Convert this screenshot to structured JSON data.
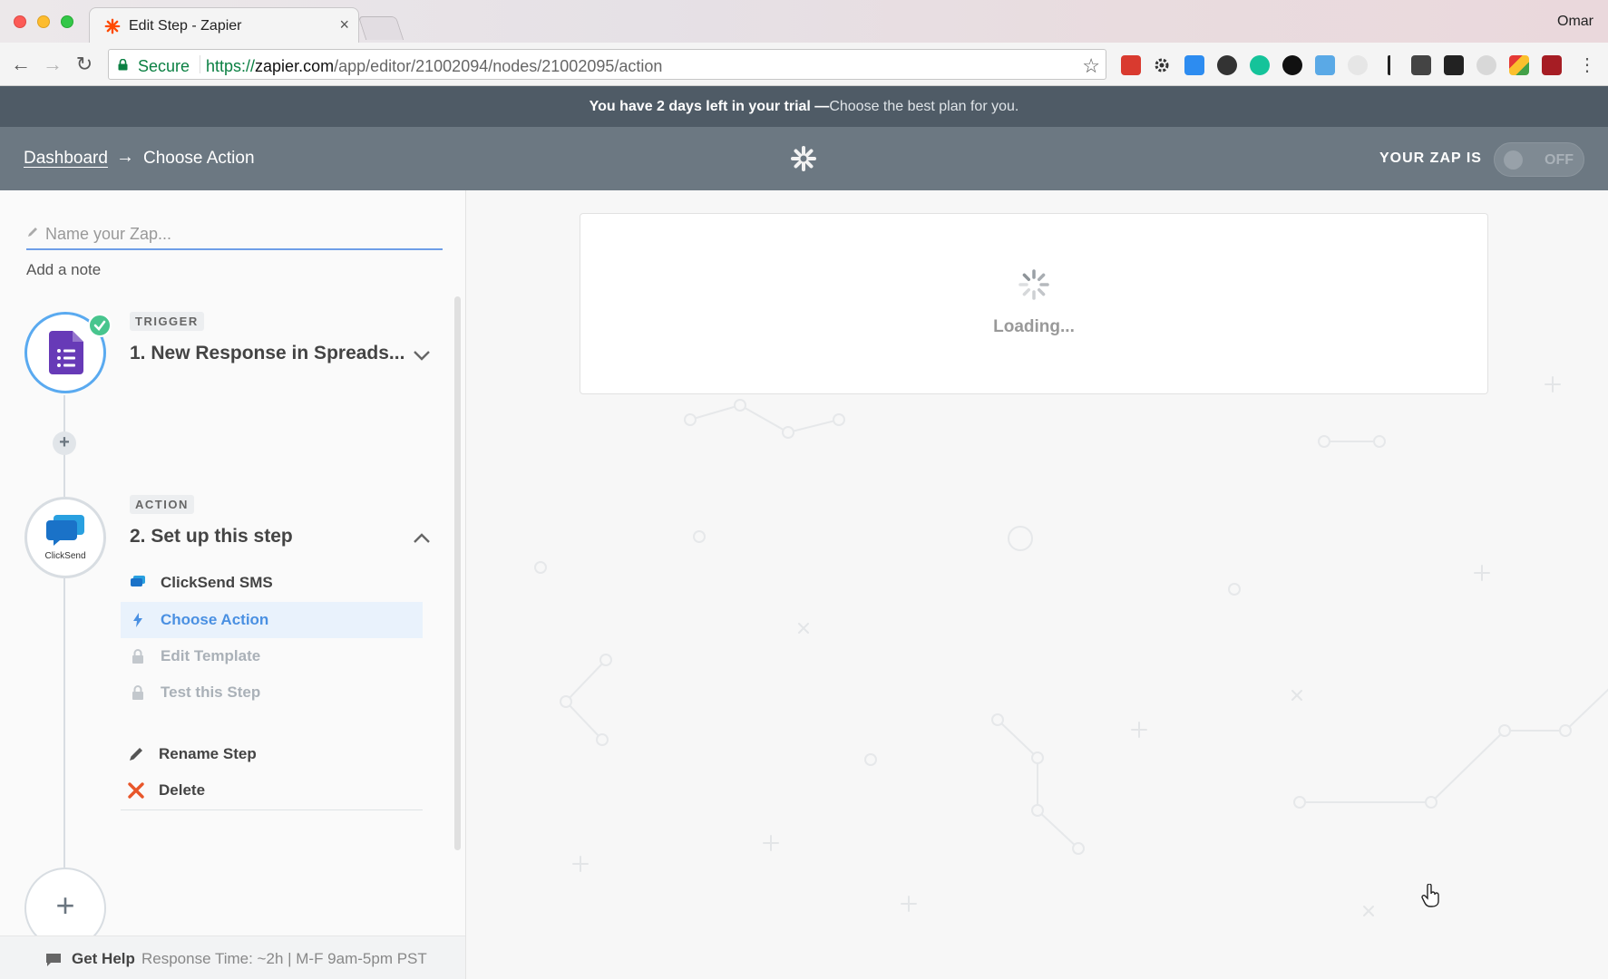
{
  "browser": {
    "tab_title": "Edit Step - Zapier",
    "tab_close": "×",
    "profile_name": "Omar",
    "secure_label": "Secure",
    "url_protocol": "https://",
    "url_host": "zapier.com",
    "url_path": "/app/editor/21002094/nodes/21002095/action",
    "extensions": [
      "calendar-ext-icon",
      "gear-ext-icon",
      "window-ext-icon",
      "camera-ext-icon",
      "grammarly-ext-icon",
      "onepassword-ext-icon",
      "fi-ext-icon",
      "feather-ext-icon",
      "text-cursor-ext-icon",
      "pocket-ext-icon",
      "buffer-ext-icon",
      "settings-ext-icon",
      "shield-ext-icon",
      "ublock-ext-icon"
    ]
  },
  "trial": {
    "message": "You have 2 days left in your trial —",
    "cta": "Choose the best plan for you."
  },
  "appbar": {
    "dashboard": "Dashboard",
    "arrow": "→",
    "current": "Choose Action",
    "zap_status_label": "YOUR ZAP IS",
    "toggle_label": "OFF"
  },
  "sidebar": {
    "name_placeholder": "Name your Zap...",
    "add_note": "Add a note",
    "trigger": {
      "tag": "TRIGGER",
      "title": "1. New Response in Spreads..."
    },
    "action": {
      "tag": "ACTION",
      "title": "2. Set up this step",
      "app_label": "ClickSend",
      "items": [
        {
          "label": "ClickSend SMS"
        },
        {
          "label": "Choose Action"
        },
        {
          "label": "Edit Template"
        },
        {
          "label": "Test this Step"
        }
      ],
      "rename": "Rename Step",
      "delete": "Delete"
    },
    "help": {
      "label": "Get Help",
      "response_time": "Response Time: ~2h | M-F 9am-5pm PST"
    }
  },
  "main": {
    "loading_text": "Loading..."
  },
  "colors": {
    "accent": "#4a90e2",
    "trial_bar": "#4f5b66",
    "app_bar": "#6c7882",
    "forms_purple": "#673ab7",
    "success_green": "#48c58e",
    "delete_red": "#e8562a"
  }
}
